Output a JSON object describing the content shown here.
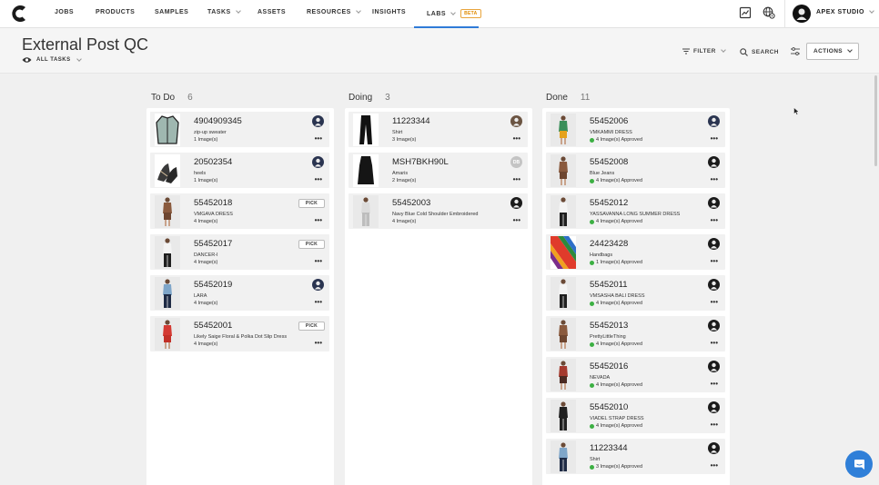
{
  "nav": {
    "items": [
      {
        "label": "JOBS",
        "has_caret": false
      },
      {
        "label": "PRODUCTS",
        "has_caret": false
      },
      {
        "label": "SAMPLES",
        "has_caret": false
      },
      {
        "label": "TASKS",
        "has_caret": true
      },
      {
        "label": "ASSETS",
        "has_caret": false
      },
      {
        "label": "RESOURCES",
        "has_caret": true
      },
      {
        "label": "INSIGHTS",
        "has_caret": false
      },
      {
        "label": "LABS",
        "has_caret": true,
        "badge": "BETA",
        "active": true
      }
    ],
    "studio": "APEX STUDIO",
    "icons": [
      "logo-icon",
      "presentation-icon",
      "globe-settings-icon"
    ],
    "accent": "#2f7bd8"
  },
  "header": {
    "title": "External Post QC",
    "view": "ALL TASKS",
    "filter": "FILTER",
    "search": "SEARCH",
    "actions": "ACTIONS"
  },
  "columns": [
    {
      "name": "To Do",
      "count": "6",
      "cards": [
        {
          "id": "4904909345",
          "sub": "zip-up sweater",
          "images": "1 Image(s)",
          "approved": false,
          "avatar": "navy",
          "pick": false,
          "thumb": "sweater"
        },
        {
          "id": "20502354",
          "sub": "heels",
          "images": "1 Image(s)",
          "approved": false,
          "avatar": "navy",
          "pick": false,
          "thumb": "heels"
        },
        {
          "id": "55452018",
          "sub": "VMGAVA DRESS",
          "images": "4 Image(s)",
          "approved": false,
          "avatar": "",
          "pick": true,
          "thumb": "brown"
        },
        {
          "id": "55452017",
          "sub": "DANCER-I",
          "images": "4 Image(s)",
          "approved": false,
          "avatar": "",
          "pick": true,
          "thumb": "white"
        },
        {
          "id": "55452019",
          "sub": "LARA",
          "images": "4 Image(s)",
          "approved": false,
          "avatar": "navy",
          "pick": false,
          "thumb": "blue"
        },
        {
          "id": "55452001",
          "sub": "Likely Saige Floral & Polka Dot Slip Dress",
          "images": "4 Image(s)",
          "approved": false,
          "avatar": "",
          "pick": true,
          "thumb": "red"
        }
      ]
    },
    {
      "name": "Doing",
      "count": "3",
      "cards": [
        {
          "id": "11223344",
          "sub": "Shirt",
          "images": "3 Image(s)",
          "approved": false,
          "avatar": "photo",
          "pick": false,
          "thumb": "pants"
        },
        {
          "id": "MSH7BKH90L",
          "sub": "Amaris",
          "images": "2 Image(s)",
          "approved": false,
          "avatar": "grey",
          "avatar_text": "DB",
          "pick": false,
          "thumb": "blackdress"
        },
        {
          "id": "55452003",
          "sub": "Navy Blue Cold Shoulder Embroidered",
          "images": "4 Image(s)",
          "approved": false,
          "avatar": "dark",
          "pick": false,
          "thumb": "grey"
        }
      ]
    },
    {
      "name": "Done",
      "count": "11",
      "cards": [
        {
          "id": "55452006",
          "sub": "VMKAMMI DRESS",
          "images": "4 Image(s) Approved",
          "approved": true,
          "avatar": "navy",
          "pick": false,
          "thumb": "green"
        },
        {
          "id": "55452008",
          "sub": "Blue Jeans",
          "images": "4 Image(s) Approved",
          "approved": true,
          "avatar": "dark",
          "pick": false,
          "thumb": "brown"
        },
        {
          "id": "55452012",
          "sub": "YASSAVANNA LONG SUMMER DRESS",
          "images": "4 Image(s) Approved",
          "approved": true,
          "avatar": "dark",
          "pick": false,
          "thumb": "white"
        },
        {
          "id": "24423428",
          "sub": "Handbags",
          "images": "1 Image(s) Approved",
          "approved": true,
          "avatar": "dark",
          "pick": false,
          "thumb": "stripes"
        },
        {
          "id": "55452011",
          "sub": "VMSASHA BALI DRESS",
          "images": "4 Image(s) Approved",
          "approved": true,
          "avatar": "dark",
          "pick": false,
          "thumb": "white"
        },
        {
          "id": "55452013",
          "sub": "PrettyLittleThing",
          "images": "4 Image(s) Approved",
          "approved": true,
          "avatar": "dark",
          "pick": false,
          "thumb": "brown"
        },
        {
          "id": "55452016",
          "sub": "NEVADA",
          "images": "4 Image(s) Approved",
          "approved": true,
          "avatar": "dark",
          "pick": false,
          "thumb": "floral"
        },
        {
          "id": "55452010",
          "sub": "VIADEL STRAP DRESS",
          "images": "4 Image(s) Approved",
          "approved": true,
          "avatar": "dark",
          "pick": false,
          "thumb": "black"
        },
        {
          "id": "11223344",
          "sub": "Shirt",
          "images": "3 Image(s) Approved",
          "approved": true,
          "avatar": "dark",
          "pick": false,
          "thumb": "blue"
        }
      ]
    }
  ],
  "pick_label": "PICK",
  "more_label": "•••"
}
